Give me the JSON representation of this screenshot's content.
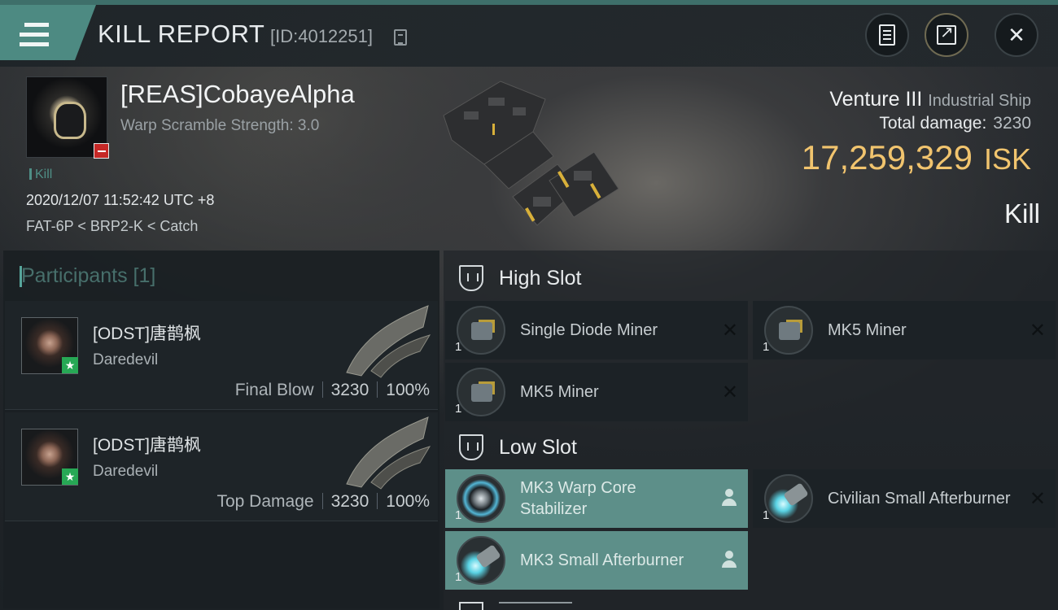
{
  "header": {
    "title": "KILL REPORT",
    "report_id": "[ID:4012251]",
    "icons": [
      "menu-icon",
      "copy-icon",
      "report-icon",
      "share-icon",
      "close-icon"
    ]
  },
  "victim": {
    "name": "[REAS]CobayeAlpha",
    "scramble": "Warp Scramble Strength: 3.0",
    "tag": "Kill",
    "datetime": "2020/12/07 11:52:42 UTC +8",
    "route": "FAT-6P < BRP2-K < Catch"
  },
  "ship": {
    "name": "Venture III",
    "class": "Industrial Ship",
    "total_damage_label": "Total damage:",
    "total_damage": "3230",
    "isk_value": "17,259,329",
    "isk_unit": "ISK",
    "result": "Kill"
  },
  "participants": {
    "title": "Participants [1]",
    "rows": [
      {
        "name": "[ODST]唐鹊枫",
        "ship": "Daredevil",
        "role": "Final Blow",
        "damage": "3230",
        "percent": "100%"
      },
      {
        "name": "[ODST]唐鹊枫",
        "ship": "Daredevil",
        "role": "Top Damage",
        "damage": "3230",
        "percent": "100%"
      }
    ]
  },
  "slots": {
    "high": {
      "label": "High Slot",
      "modules": [
        {
          "name": "Single Diode Miner",
          "count": "1",
          "status": "destroyed"
        },
        {
          "name": "MK5 Miner",
          "count": "1",
          "status": "destroyed"
        },
        {
          "name": "MK5 Miner",
          "count": "1",
          "status": "destroyed"
        }
      ]
    },
    "low": {
      "label": "Low Slot",
      "modules": [
        {
          "name": "MK3 Warp Core Stabilizer",
          "count": "1",
          "status": "dropped"
        },
        {
          "name": "Civilian Small Afterburner",
          "count": "1",
          "status": "destroyed"
        },
        {
          "name": "MK3 Small Afterburner",
          "count": "1",
          "status": "dropped"
        }
      ]
    }
  },
  "colors": {
    "accent": "#4d8a82",
    "isk": "#f1c46e",
    "highlight_row": "#5d8f89",
    "star_badge": "#27a855",
    "loss_badge": "#c52826"
  }
}
